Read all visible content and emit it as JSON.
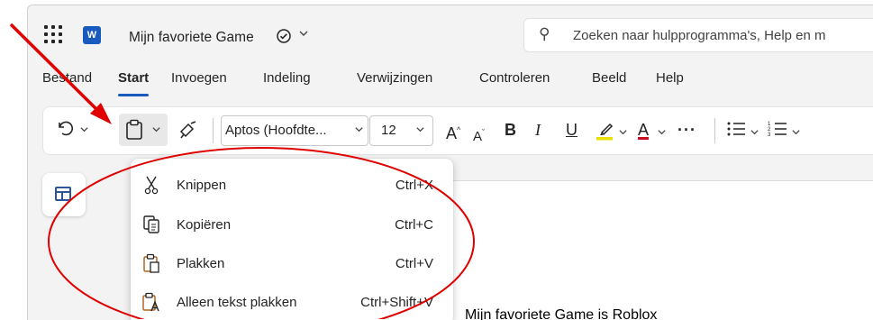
{
  "titlebar": {
    "app_icon": "W",
    "doc_title": "Mijn favoriete Game",
    "save_status_icon": "cloud-sync-icon",
    "search_placeholder": "Zoeken naar hulpprogramma's, Help en m"
  },
  "tabs": [
    {
      "label": "Bestand",
      "active": false
    },
    {
      "label": "Start",
      "active": true
    },
    {
      "label": "Invoegen",
      "active": false
    },
    {
      "label": "Indeling",
      "active": false
    },
    {
      "label": "Verwijzingen",
      "active": false
    },
    {
      "label": "Controleren",
      "active": false
    },
    {
      "label": "Beeld",
      "active": false
    },
    {
      "label": "Help",
      "active": false
    }
  ],
  "ribbon": {
    "font_name": "Aptos (Hoofdte...",
    "font_size": "12",
    "grow_font": "A",
    "shrink_font": "A",
    "bold": "B",
    "italic": "I",
    "underline": "U",
    "font_color": "A",
    "more": "···",
    "highlight_color": "#e8e100",
    "font_color_value": "#c50f1f"
  },
  "paste_menu": {
    "items": [
      {
        "label": "Knippen",
        "shortcut": "Ctrl+X",
        "icon": "scissors-icon"
      },
      {
        "label": "Kopiëren",
        "shortcut": "Ctrl+C",
        "icon": "copy-icon"
      },
      {
        "label": "Plakken",
        "shortcut": "Ctrl+V",
        "icon": "clipboard-icon"
      },
      {
        "label": "Alleen tekst plakken",
        "shortcut": "Ctrl+Shift+V",
        "icon": "paste-text-only-icon"
      }
    ]
  },
  "document": {
    "body_text": "Mijn favoriete Game is Roblox"
  },
  "annotation": {
    "color": "#e00000"
  }
}
